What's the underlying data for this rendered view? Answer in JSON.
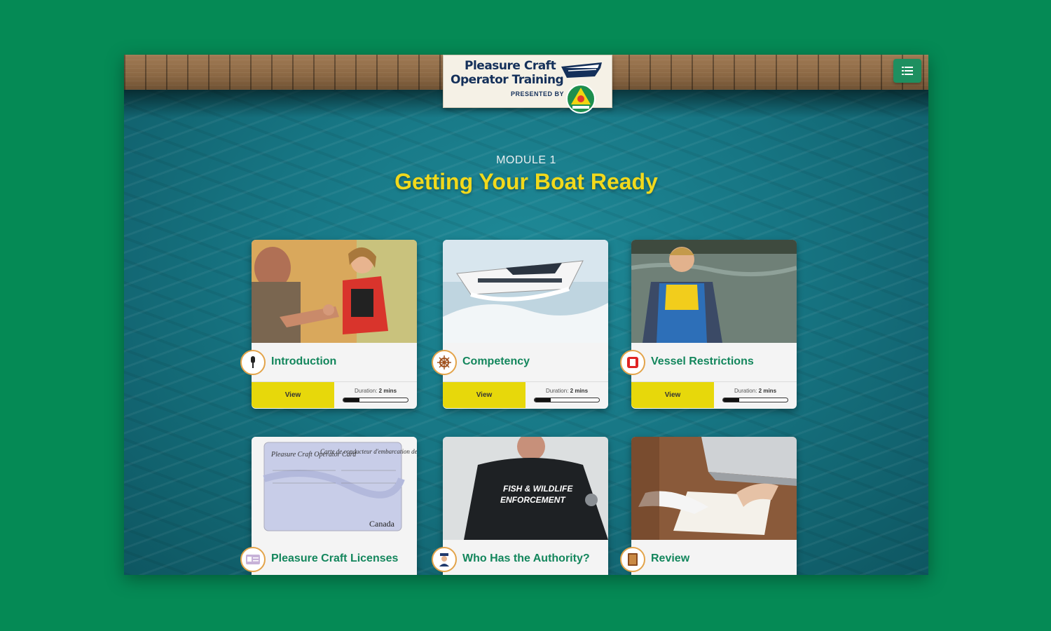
{
  "logo": {
    "line1": "Pleasure Craft",
    "line2": "Operator Training",
    "presented": "PRESENTED BY"
  },
  "header": {
    "menu_icon": "list-menu-icon"
  },
  "module": {
    "label": "MODULE 1",
    "title": "Getting Your Boat Ready"
  },
  "cards": [
    {
      "title": "Introduction",
      "icon": "microphone-icon",
      "view_label": "View",
      "duration_label": "Duration:",
      "duration_value": "2 mins",
      "progress": 0.25
    },
    {
      "title": "Competency",
      "icon": "ship-wheel-icon",
      "view_label": "View",
      "duration_label": "Duration:",
      "duration_value": "2 mins",
      "progress": 0.25
    },
    {
      "title": "Vessel Restrictions",
      "icon": "restriction-icon",
      "view_label": "View",
      "duration_label": "Duration:",
      "duration_value": "2 mins",
      "progress": 0.25
    },
    {
      "title": "Pleasure Craft Licenses",
      "icon": "id-card-icon"
    },
    {
      "title": "Who Has the Authority?",
      "icon": "officer-icon"
    },
    {
      "title": "Review",
      "icon": "book-icon"
    }
  ],
  "card_images": {
    "licence_title_en": "Pleasure Craft Operator Card",
    "licence_title_fr": "Carte de conducteur d'embarcation de plaisance",
    "licence_country": "Canada",
    "jacket_text_1": "FISH & WILDLIFE",
    "jacket_text_2": "ENFORCEMENT"
  },
  "colors": {
    "background": "#058a55",
    "accent_yellow": "#e7d80b",
    "title_green": "#13865c",
    "module_title": "#f1d91c"
  }
}
